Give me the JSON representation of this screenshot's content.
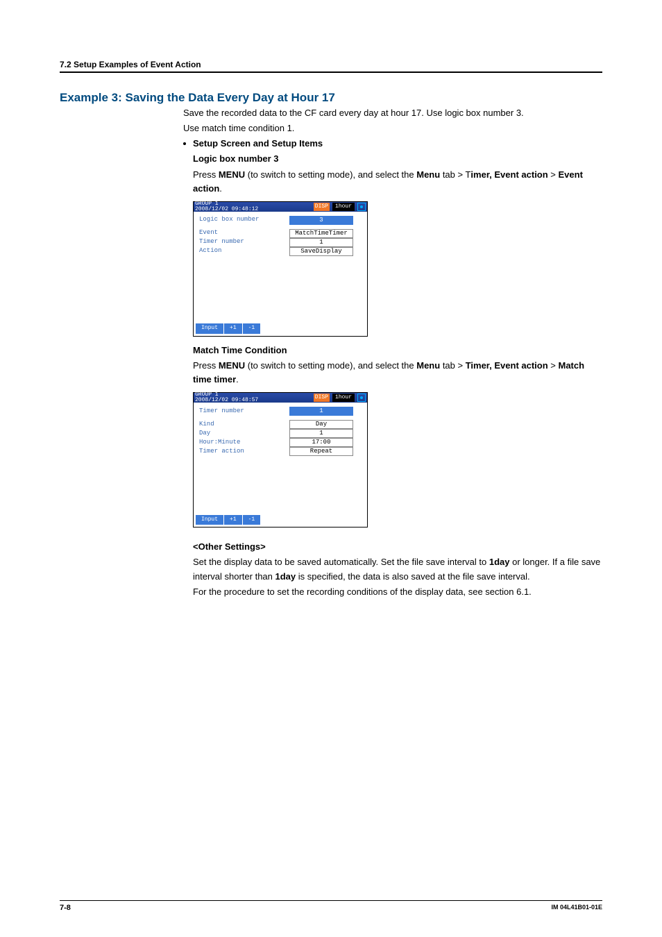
{
  "header": {
    "section": "7.2  Setup Examples of Event Action"
  },
  "title": "Example 3: Saving the Data Every Day at Hour 17",
  "intro1": "Save the recorded data to the CF card every day at hour 17. Use logic box number 3.",
  "intro2": "Use match time condition 1.",
  "setup_head": "Setup Screen and Setup Items",
  "logic_head": "Logic box number 3",
  "logic_instr": {
    "p1": "Press ",
    "menu": "MENU",
    "p2": " (to switch to setting mode), and select the ",
    "tab": "Menu",
    "p3": " tab > T",
    "timer": "imer, Event action",
    "gt": " > ",
    "ea": "Event action",
    "end": "."
  },
  "ss1": {
    "group": "GROUP 1",
    "ts": "2008/12/02 09:48:12",
    "disp": "DISP",
    "rate": "1hour",
    "r1": {
      "label": "Logic box number",
      "val": "3"
    },
    "r2": {
      "label": "Event",
      "val": "MatchTimeTimer"
    },
    "r3": {
      "label": " Timer number",
      "val": "1"
    },
    "r4": {
      "label": "Action",
      "val": "SaveDisplay"
    },
    "btns": [
      "Input",
      "+1",
      "-1"
    ]
  },
  "match_head": "Match Time Condition",
  "match_instr": {
    "p1": "Press ",
    "menu": "MENU",
    "p2": " (to switch to setting mode), and select the ",
    "tab": "Menu",
    "p3": " tab > ",
    "timer": "Timer, Event action",
    "gt": " > ",
    "mt": "Match time timer",
    "end": "."
  },
  "ss2": {
    "group": "GROUP 1",
    "ts": "2008/12/02 09:48:57",
    "disp": "DISP",
    "rate": "1hour",
    "r1": {
      "label": "Timer number",
      "val": "1"
    },
    "r2": {
      "label": "Kind",
      "val": "Day"
    },
    "r3": {
      "label": "Day",
      "val": "1"
    },
    "r4": {
      "label": "Hour:Minute",
      "val": "17:00"
    },
    "r5": {
      "label": "Timer action",
      "val": "Repeat"
    },
    "btns": [
      "Input",
      "+1",
      "-1"
    ]
  },
  "other_head": "<Other Settings>",
  "other": {
    "p1a": "Set the display data to be saved automatically. Set the file save interval to ",
    "b1": "1day",
    "p1b": " or longer. If a file save interval shorter than ",
    "b2": "1day",
    "p1c": " is specified, the data is also saved at the file save interval.",
    "p2": "For the procedure to set the recording conditions of the display data, see section 6.1."
  },
  "footer": {
    "page": "7-8",
    "doc": "IM 04L41B01-01E"
  }
}
